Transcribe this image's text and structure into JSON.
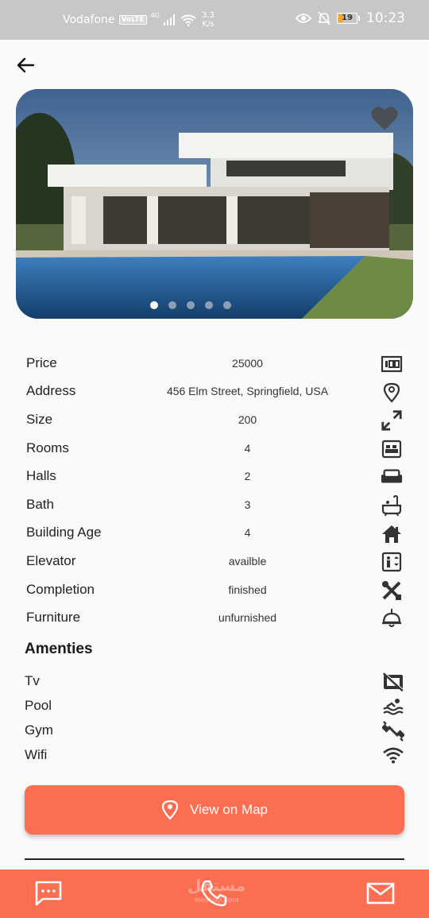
{
  "status_bar": {
    "carrier": "Vodafone",
    "volte": "VoLTE",
    "network": "4G",
    "speed_value": "3.3",
    "speed_unit": "K/s",
    "battery": "19",
    "time": "10:23"
  },
  "property": {
    "image_count": 5,
    "active_image_index": 0,
    "details": [
      {
        "label": "Price",
        "value": "25000",
        "icon": "money-icon"
      },
      {
        "label": "Address",
        "value": "456 Elm Street, Springfield, USA",
        "icon": "location-pin-icon"
      },
      {
        "label": "Size",
        "value": "200",
        "icon": "expand-arrows-icon"
      },
      {
        "label": "Rooms",
        "value": "4",
        "icon": "bed-icon"
      },
      {
        "label": "Halls",
        "value": "2",
        "icon": "sofa-icon"
      },
      {
        "label": "Bath",
        "value": "3",
        "icon": "bathtub-icon"
      },
      {
        "label": "Building Age",
        "value": "4",
        "icon": "house-icon"
      },
      {
        "label": "Elevator",
        "value": "availble",
        "icon": "elevator-icon"
      },
      {
        "label": "Completion",
        "value": "finished",
        "icon": "tools-icon"
      },
      {
        "label": "Furniture",
        "value": "unfurnished",
        "icon": "lamp-icon"
      }
    ]
  },
  "amenities": {
    "title": "Amenties",
    "items": [
      {
        "label": "Tv",
        "icon": "tv-off-icon"
      },
      {
        "label": "Pool",
        "icon": "pool-icon"
      },
      {
        "label": "Gym",
        "icon": "dumbbell-icon"
      },
      {
        "label": "Wifi",
        "icon": "wifi-icon"
      }
    ]
  },
  "actions": {
    "map_button_label": "View on Map"
  },
  "watermark": {
    "text": "مستقل",
    "sub": "mostaql.com"
  },
  "colors": {
    "accent": "#fb6e52",
    "status_bar": "#c7c7c7",
    "background": "#fafafa"
  }
}
